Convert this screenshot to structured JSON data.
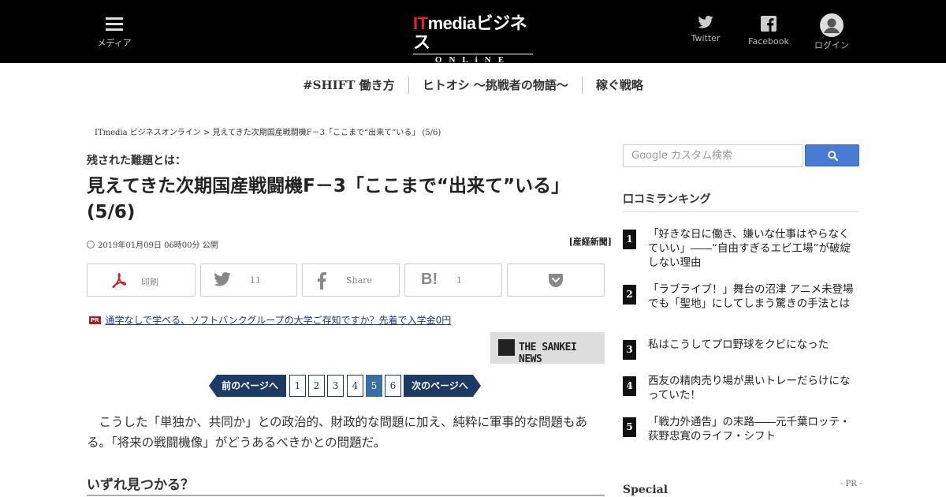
{
  "header": {
    "menu_label": "メディア",
    "logo_line1_it": "IT",
    "logo_line1_rest": "mediaビジネス",
    "logo_line2": "ONLiNE",
    "twitter_label": "Twitter",
    "facebook_label": "Facebook",
    "login_label": "ログイン"
  },
  "category_nav": [
    "#SHIFT 働き方",
    "ヒトオシ ～挑戦者の物語～",
    "稼ぐ戦略"
  ],
  "breadcrumb": "ITmedia ビジネスオンライン > 見えてきた次期国産戦闘機F－3「ここまで“出来て”いる」 (5/6)",
  "article": {
    "kicker": "残された難題とは：",
    "title": "見えてきた次期国産戦闘機F－3「ここまで“出来て”いる」(5/6)",
    "date": "2019年01月09日 06時00分 公開",
    "source": "[産経新聞]",
    "share": {
      "print_label": "印刷",
      "twitter_count": "11",
      "facebook_label": "Share",
      "hatena_count": "1"
    },
    "pr_tag": "PR",
    "pr_link": "通学なしで学べる、ソフトバンクグループの大学ご存知ですか？先着で入学金0円",
    "sankei_label": "THE SANKEI NEWS",
    "pager": {
      "prev": "前のページへ",
      "next": "次のページへ",
      "pages": [
        "1",
        "2",
        "3",
        "4",
        "5",
        "6"
      ],
      "current": "5"
    },
    "body": "こうした「単独か、共同か」との政治的、財政的な問題に加え、純粋に軍事的な問題もある。「将来の戦闘機像」がどうあるべきかとの問題だ。",
    "subhead": "いずれ見つかる？"
  },
  "sidebar": {
    "search_placeholder": "Google カスタム検索",
    "ranking_title": "口コミランキング",
    "ranking": [
      {
        "rank": "1",
        "text": "「好きな日に働き、嫌いな仕事はやらなくていい」――“自由すぎるエビ工場”が破綻しない理由"
      },
      {
        "rank": "2",
        "text": "「ラブライブ！」舞台の沼津 アニメ未登場でも「聖地」にしてしまう驚きの手法とは"
      },
      {
        "rank": "3",
        "text": "私はこうしてプロ野球をクビになった"
      },
      {
        "rank": "4",
        "text": "西友の精肉売り場が黒いトレーだらけになっていた！"
      },
      {
        "rank": "5",
        "text": "「戦力外通告」の末路――元千葉ロッテ・荻野忠寛のライフ・シフト"
      }
    ],
    "special_title": "Special",
    "special_pr": "- PR -"
  },
  "colors": {
    "header_bg": "#000000",
    "logo_accent": "#e8202a",
    "pager_bg": "#1c3a64",
    "pager_current": "#3a6ea5",
    "search_button": "#4a7bd4",
    "pr_tag": "#b4182b"
  }
}
